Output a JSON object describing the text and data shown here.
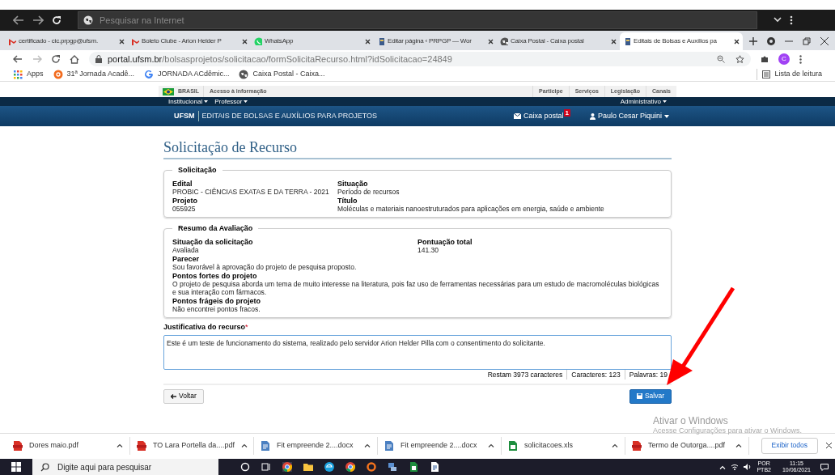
{
  "browser": {
    "search_placeholder": "Pesquisar na Internet",
    "tabs": [
      {
        "title": "certificado - cic.prpgp@ufsm.",
        "selected": false
      },
      {
        "title": "Boleto Clube - Arion Helder P",
        "selected": false
      },
      {
        "title": "WhatsApp",
        "selected": false
      },
      {
        "title": "Editar página ‹ PRPGP — Wor",
        "selected": false
      },
      {
        "title": "Caixa Postal - Caixa postal",
        "selected": false
      },
      {
        "title": "Editais de Bolsas e Auxílios pa",
        "selected": true
      }
    ],
    "url_host": "portal.ufsm.br",
    "url_path": "/bolsasprojetos/solicitacao/formSolicitaRecurso.html?idSolicitacao=24849",
    "profile_initial": "C",
    "bookmarks": [
      {
        "label": "Apps"
      },
      {
        "label": "31ª Jornada Acadê..."
      },
      {
        "label": "JORNADA ACdêmic..."
      },
      {
        "label": "Caixa Postal - Caixa..."
      }
    ],
    "reading_list": "Lista de leitura"
  },
  "gov_bar": {
    "country": "BRASIL",
    "access": "Acesso à informação",
    "links": [
      "Participe",
      "Serviços",
      "Legislação",
      "Canais"
    ]
  },
  "nav_bar": {
    "menus_left": [
      "Institucional",
      "Professor"
    ],
    "menus_right": [
      "Administrativo"
    ]
  },
  "header": {
    "logo": "UFSM",
    "title": "EDITAIS DE BOLSAS E AUXÍLIOS PARA PROJETOS",
    "mailbox": "Caixa postal",
    "mail_count": "1",
    "user": "Paulo Cesar Piquini"
  },
  "page_title": "Solicitação de Recurso",
  "sections": [
    {
      "legend": "Solicitação",
      "fields": [
        {
          "label": "Edital",
          "value": "PROBIC - CIÊNCIAS EXATAS E DA TERRA - 2021"
        },
        {
          "label": "Situação",
          "value": "Período de recursos"
        },
        {
          "label": "Projeto",
          "value": "055925"
        },
        {
          "label": "Título",
          "value": "Moléculas e materiais nanoestruturados para aplicações em energia, saúde e ambiente"
        }
      ]
    },
    {
      "legend": "Resumo da Avaliação",
      "fields": [
        {
          "label": "Situação da solicitação",
          "value": "Avaliada"
        },
        {
          "label": "Pontuação total",
          "value": "141.30"
        },
        {
          "label": "Parecer",
          "value": "Sou favorável à aprovação do projeto de pesquisa proposto."
        },
        {
          "label": "Pontos fortes do projeto",
          "value": "O projeto de pesquisa aborda um tema de muito interesse na literatura, pois faz uso de ferramentas necessárias para um estudo de macromoléculas biológicas e sua interação com fármacos."
        },
        {
          "label": "Pontos frágeis do projeto",
          "value": "Não encontrei pontos fracos."
        }
      ]
    }
  ],
  "justification": {
    "label": "Justificativa do recurso",
    "required_mark": "*",
    "value": "Este é um teste de funcionamento do sistema, realizado pelo servidor Arion Helder Pilla com o consentimento do solicitante.",
    "counters": [
      "Restam 3973 caracteres",
      "Caracteres: 123",
      "Palavras: 19"
    ]
  },
  "buttons": {
    "back": "Voltar",
    "save": "Salvar"
  },
  "activation_notice": {
    "title": "Ativar o Windows",
    "text": "Acesse Configurações para ativar o Windows."
  },
  "downloads": {
    "items": [
      {
        "name": "Dores maio.pdf",
        "kind": "pdf"
      },
      {
        "name": "TO Lara Portella da....pdf",
        "kind": "pdf"
      },
      {
        "name": "Fit empreende 2....docx",
        "kind": "doc"
      },
      {
        "name": "Fit empreende 2....docx",
        "kind": "doc"
      },
      {
        "name": "solicitacoes.xls",
        "kind": "sheet"
      },
      {
        "name": "Termo de Outorga....pdf",
        "kind": "pdf"
      }
    ],
    "show_all": "Exibir todos"
  },
  "taskbar": {
    "search_placeholder": "Digite aqui para pesquisar",
    "language": "POR",
    "layout": "PTB2",
    "time": "11:15",
    "date": "10/06/2021"
  }
}
